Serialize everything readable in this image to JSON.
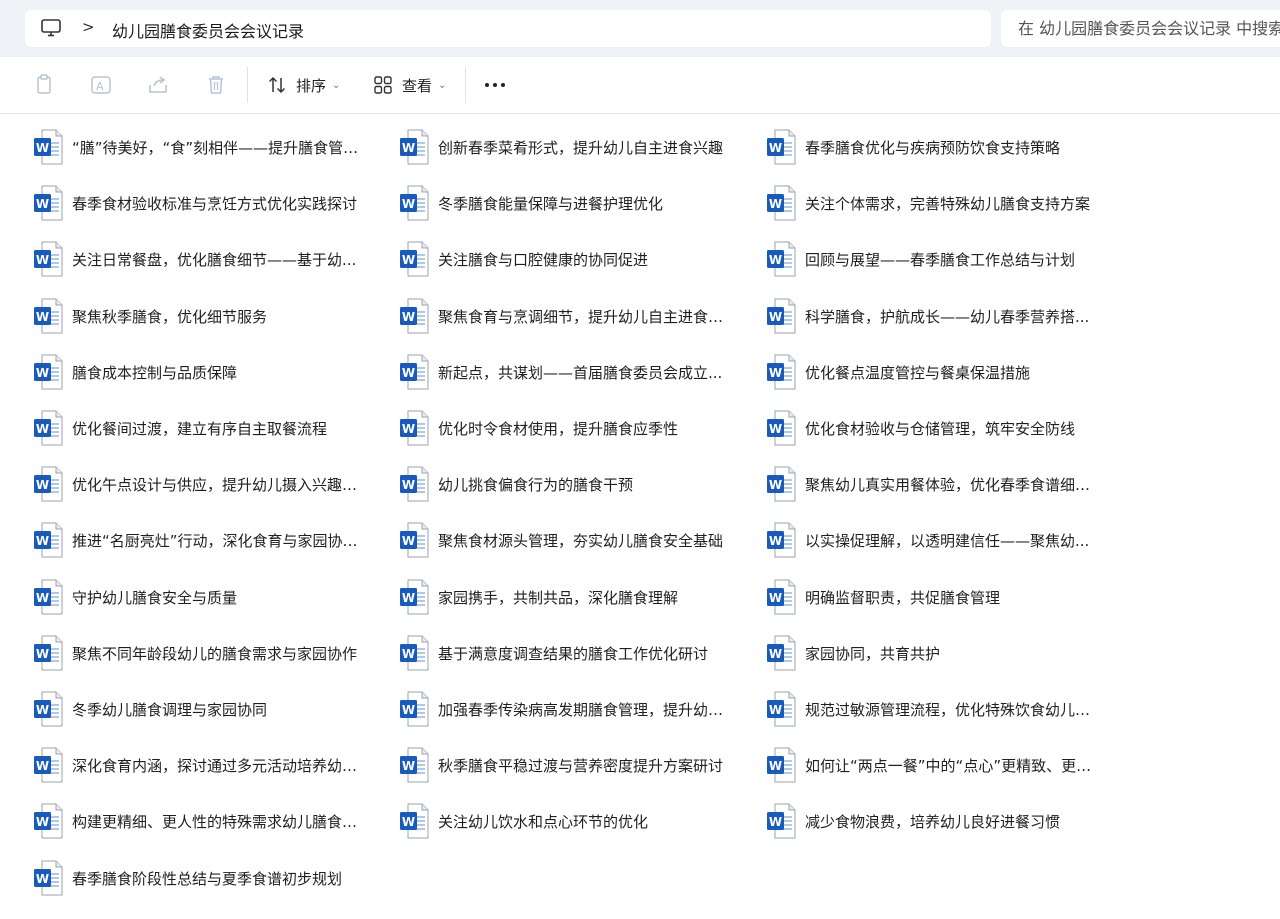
{
  "address": {
    "icon": "computer-icon",
    "separator": ">",
    "path": "幼儿园膳食委员会会议记录"
  },
  "search": {
    "placeholder": "在 幼儿园膳食委员会会议记录 中搜索"
  },
  "toolbar": {
    "sort_label": "排序",
    "view_label": "查看"
  },
  "files": {
    "col1": [
      "“膳”待美好，“食”刻相伴——提升膳食管理...",
      "春季食材验收标准与烹饪方式优化实践探讨",
      "关注日常餐盘，优化膳食细节——基于幼...",
      "聚焦秋季膳食，优化细节服务",
      "膳食成本控制与品质保障",
      "优化餐间过渡，建立有序自主取餐流程",
      "优化午点设计与供应，提升幼儿摄入兴趣与...",
      "推进“名厨亮灶”行动，深化食育与家园协同...",
      "守护幼儿膳食安全与质量",
      "聚焦不同年龄段幼儿的膳食需求与家园协作",
      "冬季幼儿膳食调理与家园协同",
      "深化食育内涵，探讨通过多元活动培养幼儿...",
      "构建更精细、更人性的特殊需求幼儿膳食支...",
      "春季膳食阶段性总结与夏季食谱初步规划"
    ],
    "col2": [
      "创新春季菜肴形式，提升幼儿自主进食兴趣",
      "冬季膳食能量保障与进餐护理优化",
      "关注膳食与口腔健康的协同促进",
      "聚焦食育与烹调细节，提升幼儿自主进食意...",
      "新起点，共谋划——首届膳食委员会成立...",
      "优化时令食材使用，提升膳食应季性",
      "幼儿挑食偏食行为的膳食干预",
      "聚焦食材源头管理，夯实幼儿膳食安全基础",
      "家园携手，共制共品，深化膳食理解",
      "基于满意度调查结果的膳食工作优化研讨",
      "加强春季传染病高发期膳食管理，提升幼儿...",
      "秋季膳食平稳过渡与营养密度提升方案研讨",
      "关注幼儿饮水和点心环节的优化"
    ],
    "col3": [
      "春季膳食优化与疾病预防饮食支持策略",
      "关注个体需求，完善特殊幼儿膳食支持方案",
      "回顾与展望——春季膳食工作总结与计划",
      "科学膳食，护航成长——幼儿春季营养搭...",
      "优化餐点温度管控与餐桌保温措施",
      "优化食材验收与仓储管理，筑牢安全防线",
      "聚焦幼儿真实用餐体验，优化春季食谱细节...",
      "以实操促理解，以透明建信任——聚焦幼...",
      "明确监督职责，共促膳食管理",
      "家园协同，共育共护",
      "规范过敏源管理流程，优化特殊饮食幼儿的...",
      "如何让“两点一餐”中的“点心”更精致、更有...",
      "减少食物浪费，培养幼儿良好进餐习惯"
    ]
  },
  "file_icon": "word-document-icon",
  "colors": {
    "word_blue": "#185abd",
    "topbar_bg": "#eef1f6"
  }
}
